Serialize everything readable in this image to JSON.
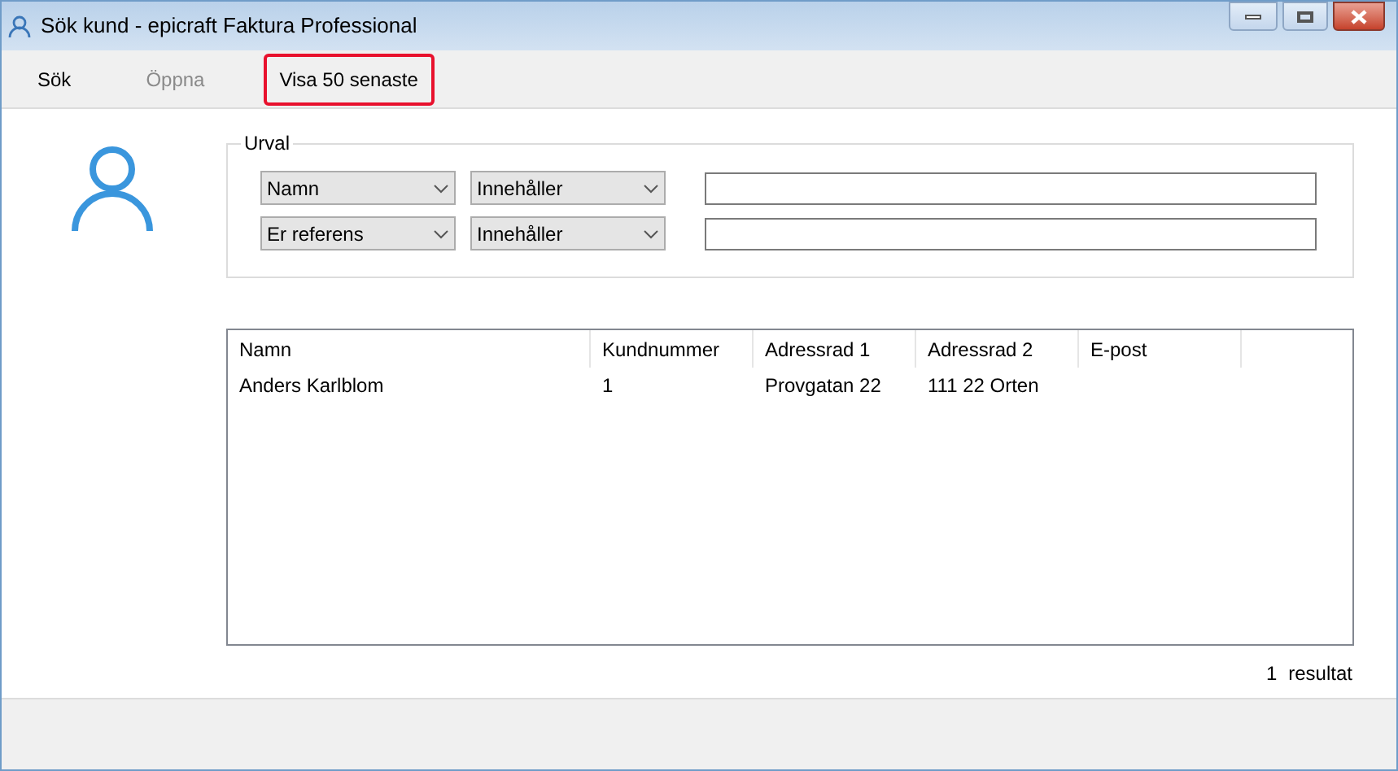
{
  "window": {
    "title": "Sök kund - epicraft Faktura Professional"
  },
  "toolbar": [
    {
      "label": "Sök",
      "disabled": false,
      "highlighted": false
    },
    {
      "label": "Öppna",
      "disabled": true,
      "highlighted": false
    },
    {
      "label": "Visa 50 senaste",
      "disabled": false,
      "highlighted": true
    }
  ],
  "filter": {
    "title": "Urval",
    "rows": [
      {
        "field": "Namn",
        "operator": "Innehåller"
      },
      {
        "field": "Er referens",
        "operator": "Innehåller"
      }
    ]
  },
  "table": {
    "columns": [
      "Namn",
      "Kundnummer",
      "Adressrad 1",
      "Adressrad 2",
      "E-post"
    ],
    "rows": [
      [
        "Anders Karlblom",
        "1",
        "Provgatan 22",
        "111 22 Orten",
        ""
      ]
    ]
  },
  "result": {
    "count": "1",
    "label": "resultat"
  }
}
